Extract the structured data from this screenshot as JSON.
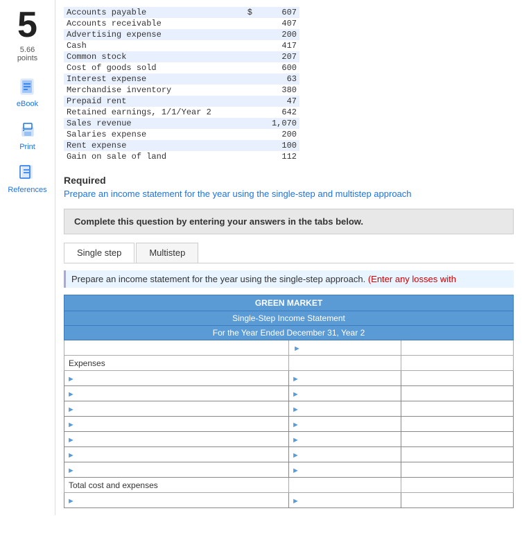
{
  "sidebar": {
    "question_number": "5",
    "points_value": "5.66",
    "points_label": "points",
    "ebook_label": "eBook",
    "print_label": "Print",
    "references_label": "References"
  },
  "data_table": {
    "items": [
      {
        "label": "Accounts payable",
        "col1": "$",
        "col2": "607"
      },
      {
        "label": "Accounts receivable",
        "col1": "",
        "col2": "407"
      },
      {
        "label": "Advertising expense",
        "col1": "",
        "col2": "200"
      },
      {
        "label": "Cash",
        "col1": "",
        "col2": "417"
      },
      {
        "label": "Common stock",
        "col1": "",
        "col2": "207"
      },
      {
        "label": "Cost of goods sold",
        "col1": "",
        "col2": "600"
      },
      {
        "label": "Interest expense",
        "col1": "",
        "col2": "63"
      },
      {
        "label": "Merchandise inventory",
        "col1": "",
        "col2": "380"
      },
      {
        "label": "Prepaid rent",
        "col1": "",
        "col2": "47"
      },
      {
        "label": "Retained earnings, 1/1/Year 2",
        "col1": "",
        "col2": "642"
      },
      {
        "label": "Sales revenue",
        "col1": "",
        "col2": "1,070"
      },
      {
        "label": "Salaries expense",
        "col1": "",
        "col2": "200"
      },
      {
        "label": "Rent expense",
        "col1": "",
        "col2": "100"
      },
      {
        "label": "Gain on sale of land",
        "col1": "",
        "col2": "112"
      }
    ]
  },
  "required": {
    "title": "Required",
    "text": "Prepare an income statement for the year using the single-step and multistep approach"
  },
  "complete_box": {
    "text": "Complete this question by entering your answers in the tabs below."
  },
  "tabs": [
    {
      "id": "single-step",
      "label": "Single step",
      "active": true
    },
    {
      "id": "multistep",
      "label": "Multistep",
      "active": false
    }
  ],
  "single_step": {
    "instruction": "Prepare an income statement for the year using the single-step approach.",
    "instruction_loss": "(Enter any losses with",
    "income_statement": {
      "title": "GREEN MARKET",
      "subtitle": "Single-Step Income Statement",
      "period": "For the Year Ended December 31, Year 2",
      "labels": {
        "expenses": "Expenses",
        "total_cost": "Total cost and expenses"
      }
    }
  }
}
